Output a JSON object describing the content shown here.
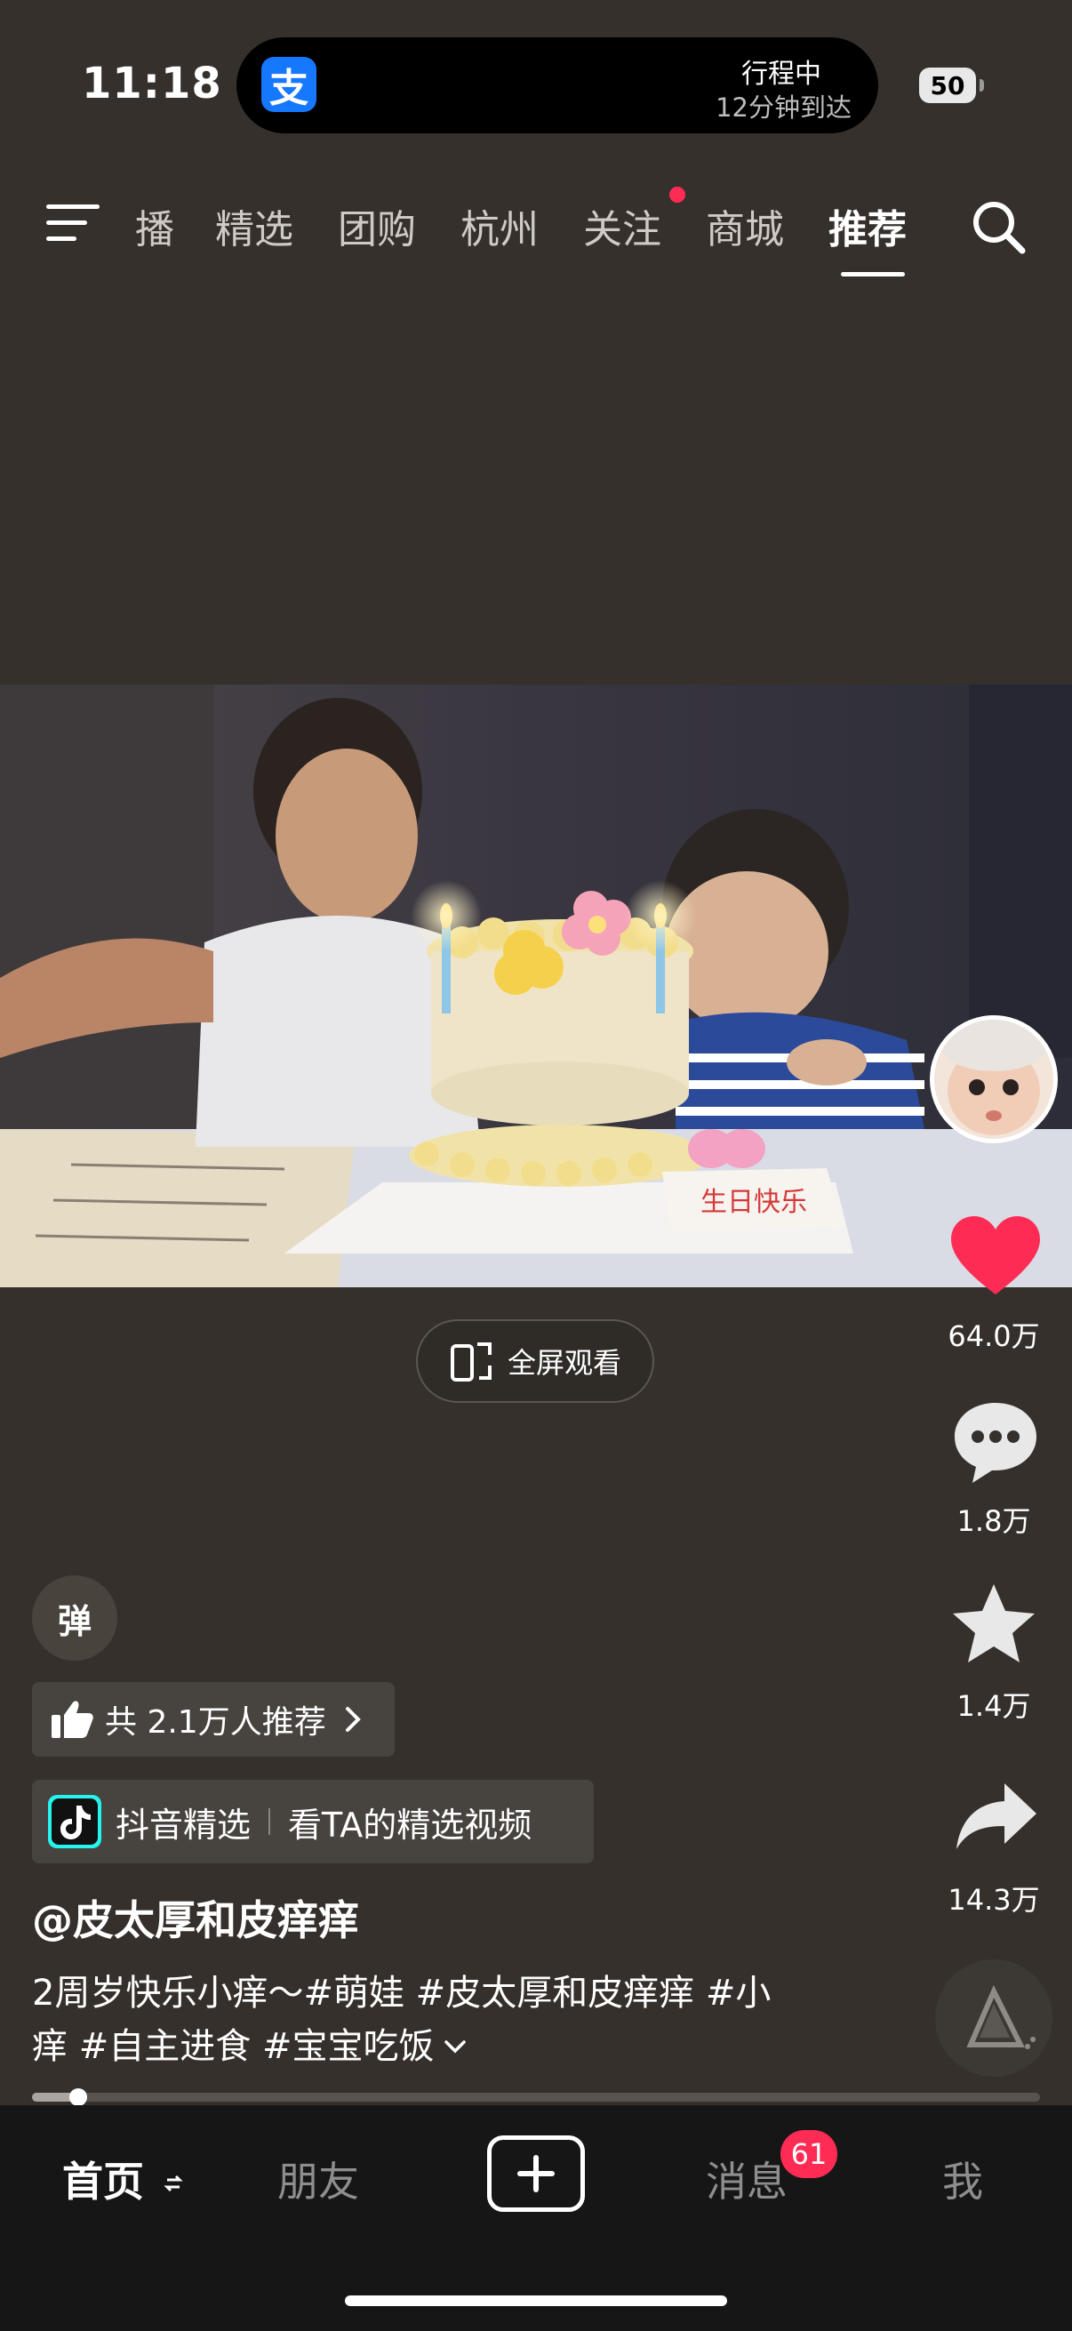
{
  "status_bar": {
    "time": "11:18",
    "trip_status": "行程中",
    "trip_eta": "12分钟到达",
    "battery": "50",
    "alipay_glyph": "支"
  },
  "top_nav": {
    "items": [
      "播",
      "精选",
      "团购",
      "杭州",
      "关注",
      "商城",
      "推荐"
    ],
    "active": "推荐"
  },
  "video": {
    "fullscreen_label": "全屏观看",
    "cake_text": "生日快乐"
  },
  "actions": {
    "likes": "64.0万",
    "comments": "1.8万",
    "favorites": "1.4万",
    "shares": "14.3万"
  },
  "overlay": {
    "danmu_label": "弹",
    "recommend_text": "共 2.1万人推荐",
    "select_brand": "抖音精选",
    "select_link": "看TA的精选视频",
    "author": "@皮太厚和皮痒痒",
    "description_line1": "2周岁快乐小痒～#萌娃 #皮太厚和皮痒痒 #小",
    "description_line2": "痒 #自主进食 #宝宝吃饭",
    "progress": 0.046
  },
  "tabbar": {
    "home": "首页",
    "friends": "朋友",
    "messages": "消息",
    "messages_badge": "61",
    "me": "我"
  },
  "colors": {
    "background": "#35302b",
    "accent_red": "#fe2c55",
    "alipay_blue": "#1677ff"
  }
}
